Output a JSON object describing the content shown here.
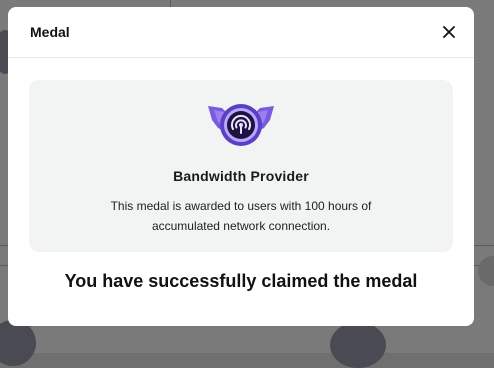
{
  "modal": {
    "title": "Medal",
    "close_icon": "close-icon",
    "medal": {
      "icon": "winged-broadcast-medal-icon",
      "name": "Bandwidth Provider",
      "description": "This medal is awarded to users with 100 hours of accumulated network connection."
    },
    "success_message": "You have successfully claimed the medal"
  },
  "colors": {
    "overlay": "#7a7a7a",
    "card_bg": "#f2f3f3",
    "medal_purple": "#5b3fc4"
  }
}
